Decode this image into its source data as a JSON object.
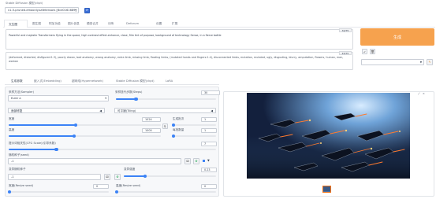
{
  "header": {
    "model_label": "Stable Diffusion 模型(ckpt)",
    "model_value": "v1-5-pruned-emaonly.safetensors [6ce0161689]"
  },
  "top_tabs": [
    "文生图",
    "图生图",
    "附加功能",
    "图片信息",
    "模型合并",
    "训练",
    "Deforum",
    "设置",
    "扩展"
  ],
  "prompt": {
    "text": "Powerful and majestic Transformers flying in the space, high contrast effect-enhance, close, film tint of purpose, background of technology Sense, in a fierce battle",
    "token_count": "32/75"
  },
  "negative_prompt": {
    "text": "(deformed, distorted, disfigured:1.3), poorly drawn, bad anatomy, wrong anatomy, extra limb, missing limb, floating limbs, (mutated hands and fingers:1.4), disconnected limbs, mutation, mutated, ugly, disgusting, blurry, amputation, flowers, human, man, woman",
    "token_count": "45/75"
  },
  "generate_button": "生成",
  "style_dropdown_arrow": "▼",
  "sub_tabs": [
    "生成参数",
    "嵌入式(Embedding)",
    "超网络(Hypernetwork)",
    "Stable Diffusion 模型(ckpt)",
    "LoRA"
  ],
  "sampler": {
    "label": "采样方法(Sampler)",
    "value": "Euler a"
  },
  "steps": {
    "label": "采样迭代步数(Steps)",
    "value": "30",
    "fraction": 0.2
  },
  "checkbox_row": {
    "face_label": "面部修复",
    "tiling_label": "可平铺(Tiling)",
    "hires_label": "高分辨率修复(Hires. fix)"
  },
  "width": {
    "label": "宽度",
    "value": "1024",
    "fraction": 0.44
  },
  "height": {
    "label": "高度",
    "value": "1000",
    "fraction": 0.43
  },
  "batch_count": {
    "label": "生成批次",
    "value": "1"
  },
  "batch_size": {
    "label": "每批数量",
    "value": "1"
  },
  "cfg": {
    "label": "提示词相关性(CFG Scale)(引导系数)",
    "value": "7",
    "fraction": 0.23
  },
  "seed": {
    "label": "随机种子(seed)",
    "value": "-1"
  },
  "extra_label": "▼",
  "var_seed": {
    "label": "变异随机种子",
    "value": "-1"
  },
  "var_strength": {
    "label": "变异强度",
    "value": "0.23"
  },
  "resize_w": {
    "label": "宽度(Resize seed)",
    "value": "0"
  },
  "resize_h": {
    "label": "高度(Resize seed)",
    "value": "0"
  },
  "script_label": "脚本",
  "output_close": "×",
  "colors": {
    "accent": "#3b82f6",
    "generate": "#f6a24e",
    "active_tab": "#f97316"
  }
}
